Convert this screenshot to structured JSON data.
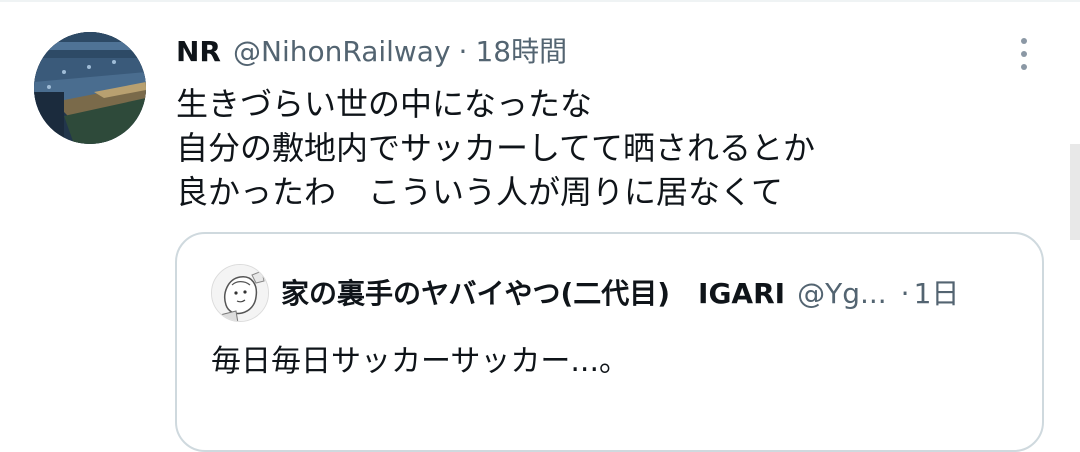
{
  "tweet": {
    "display_name": "NR",
    "handle": "@NihonRailway",
    "separator": "·",
    "time": "18時間",
    "avatar_icon": "stadium-photo-avatar",
    "more_icon": "more-vertical-icon",
    "text_lines": [
      "生きづらい世の中になったな",
      "自分の敷地内でサッカーしてて晒されるとか",
      "良かったわ　こういう人が周りに居なくて"
    ]
  },
  "quote": {
    "display_name": "家の裏手のヤバイやつ(二代目)　IGARI",
    "handle": "@Yg...",
    "separator": "·",
    "time": "1日",
    "avatar_icon": "sketch-character-avatar",
    "text": "毎日毎日サッカーサッカー...。"
  },
  "colors": {
    "text_primary": "#0f1419",
    "text_secondary": "#536471",
    "border": "#cfd9de"
  }
}
